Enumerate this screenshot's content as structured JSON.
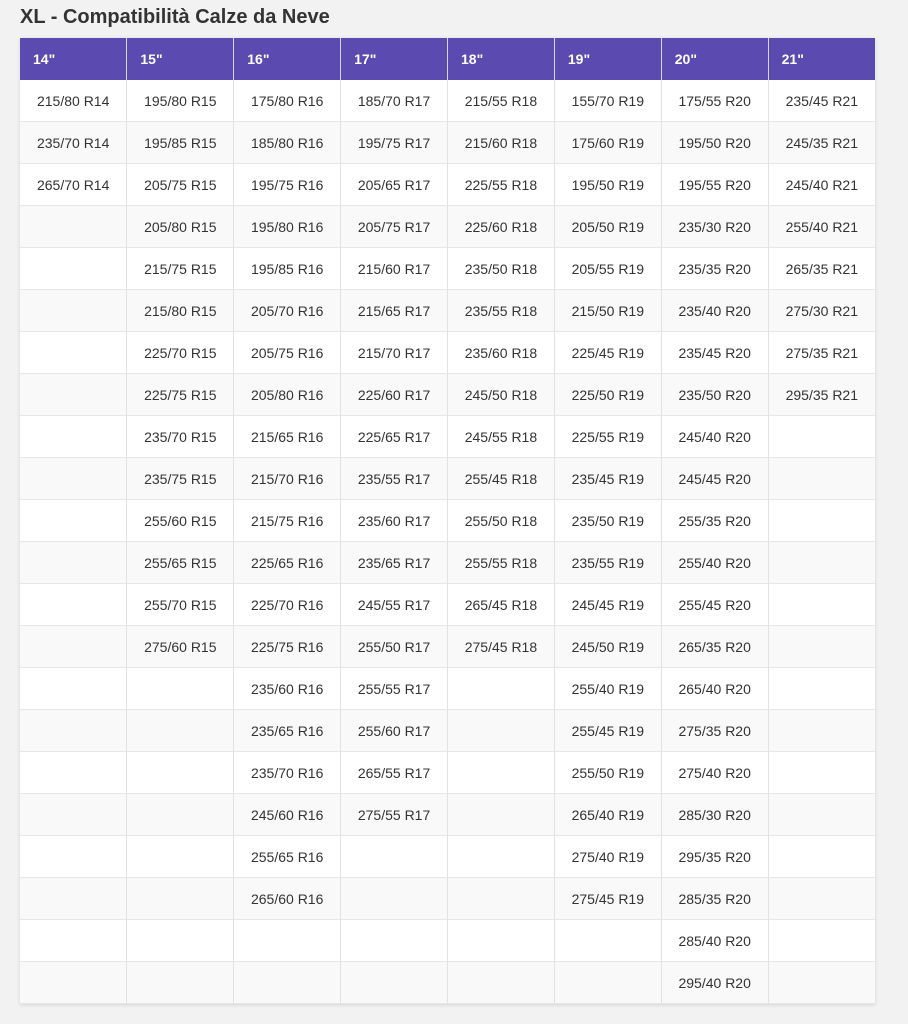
{
  "title": "XL - Compatibilità Calze da Neve",
  "columns": [
    "14\"",
    "15\"",
    "16\"",
    "17\"",
    "18\"",
    "19\"",
    "20\"",
    "21\""
  ],
  "rows": [
    [
      "215/80 R14",
      "195/80 R15",
      "175/80 R16",
      "185/70 R17",
      "215/55 R18",
      "155/70 R19",
      "175/55 R20",
      "235/45 R21"
    ],
    [
      "235/70 R14",
      "195/85 R15",
      "185/80 R16",
      "195/75 R17",
      "215/60 R18",
      "175/60 R19",
      "195/50 R20",
      "245/35 R21"
    ],
    [
      "265/70 R14",
      "205/75 R15",
      "195/75 R16",
      "205/65 R17",
      "225/55 R18",
      "195/50 R19",
      "195/55 R20",
      "245/40 R21"
    ],
    [
      "",
      "205/80 R15",
      "195/80 R16",
      "205/75 R17",
      "225/60 R18",
      "205/50 R19",
      "235/30 R20",
      "255/40 R21"
    ],
    [
      "",
      "215/75 R15",
      "195/85 R16",
      "215/60 R17",
      "235/50 R18",
      "205/55 R19",
      "235/35 R20",
      "265/35 R21"
    ],
    [
      "",
      "215/80 R15",
      "205/70 R16",
      "215/65 R17",
      "235/55 R18",
      "215/50 R19",
      "235/40 R20",
      "275/30 R21"
    ],
    [
      "",
      "225/70 R15",
      "205/75 R16",
      "215/70 R17",
      "235/60 R18",
      "225/45 R19",
      "235/45 R20",
      "275/35 R21"
    ],
    [
      "",
      "225/75 R15",
      "205/80 R16",
      "225/60 R17",
      "245/50 R18",
      "225/50 R19",
      "235/50 R20",
      "295/35 R21"
    ],
    [
      "",
      "235/70 R15",
      "215/65 R16",
      "225/65 R17",
      "245/55 R18",
      "225/55 R19",
      "245/40 R20",
      ""
    ],
    [
      "",
      "235/75 R15",
      "215/70 R16",
      "235/55 R17",
      "255/45 R18",
      "235/45 R19",
      "245/45 R20",
      ""
    ],
    [
      "",
      "255/60 R15",
      "215/75 R16",
      "235/60 R17",
      "255/50 R18",
      "235/50 R19",
      "255/35 R20",
      ""
    ],
    [
      "",
      "255/65 R15",
      "225/65 R16",
      "235/65 R17",
      "255/55 R18",
      "235/55 R19",
      "255/40 R20",
      ""
    ],
    [
      "",
      "255/70 R15",
      "225/70 R16",
      "245/55 R17",
      "265/45 R18",
      "245/45 R19",
      "255/45 R20",
      ""
    ],
    [
      "",
      "275/60 R15",
      "225/75 R16",
      "255/50 R17",
      "275/45 R18",
      "245/50 R19",
      "265/35 R20",
      ""
    ],
    [
      "",
      "",
      "235/60 R16",
      "255/55 R17",
      "",
      "255/40 R19",
      "265/40 R20",
      ""
    ],
    [
      "",
      "",
      "235/65 R16",
      "255/60 R17",
      "",
      "255/45 R19",
      "275/35 R20",
      ""
    ],
    [
      "",
      "",
      "235/70 R16",
      "265/55 R17",
      "",
      "255/50 R19",
      "275/40 R20",
      ""
    ],
    [
      "",
      "",
      "245/60 R16",
      "275/55 R17",
      "",
      "265/40 R19",
      "285/30 R20",
      ""
    ],
    [
      "",
      "",
      "255/65 R16",
      "",
      "",
      "275/40 R19",
      "295/35 R20",
      ""
    ],
    [
      "",
      "",
      "265/60 R16",
      "",
      "",
      "275/45 R19",
      "285/35 R20",
      ""
    ],
    [
      "",
      "",
      "",
      "",
      "",
      "",
      "285/40 R20",
      ""
    ],
    [
      "",
      "",
      "",
      "",
      "",
      "",
      "295/40 R20",
      ""
    ]
  ],
  "colors": {
    "header_bg": "#5b4ab0",
    "header_text": "#ffffff",
    "page_bg": "#f2f2f2"
  }
}
